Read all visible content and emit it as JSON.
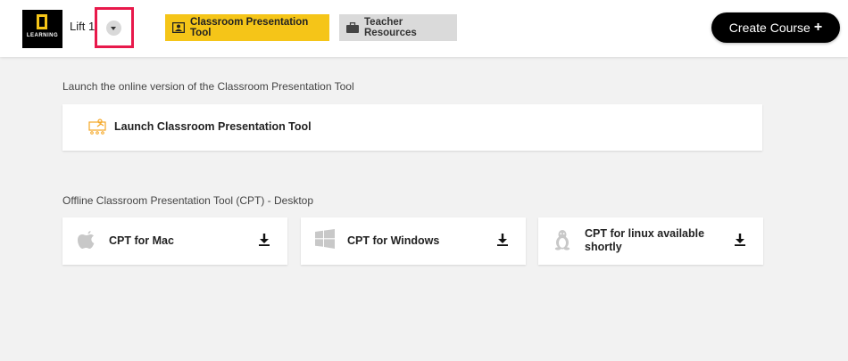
{
  "header": {
    "logo": {
      "text": "LEARNING",
      "colors": {
        "background": "#000000",
        "frame": "#f5c518"
      }
    },
    "course_selector": {
      "name": "Lift 1",
      "icon": "chevron-down-icon"
    },
    "tabs": [
      {
        "label": "Classroom Presentation Tool",
        "icon": "presentation-icon",
        "active": true,
        "color": "#f5c518"
      },
      {
        "label": "Teacher Resources",
        "icon": "briefcase-icon",
        "active": false,
        "color": "#dadada"
      }
    ],
    "create_course": {
      "label": "Create Course",
      "icon": "plus-icon",
      "plus": "+"
    }
  },
  "main": {
    "online_section": {
      "heading": "Launch the online version of the Classroom Presentation Tool",
      "launch_card": {
        "label": "Launch Classroom Presentation Tool",
        "icon": "presentation-board-icon",
        "icon_color": "#f5a623"
      }
    },
    "offline_section": {
      "heading": "Offline Classroom Presentation Tool (CPT) - Desktop",
      "downloads": [
        {
          "label": "CPT for Mac",
          "icon": "apple-icon"
        },
        {
          "label": "CPT for Windows",
          "icon": "windows-icon"
        },
        {
          "label_line1": "CPT for linux available",
          "label_line2": "shortly",
          "icon": "linux-icon"
        }
      ]
    }
  }
}
